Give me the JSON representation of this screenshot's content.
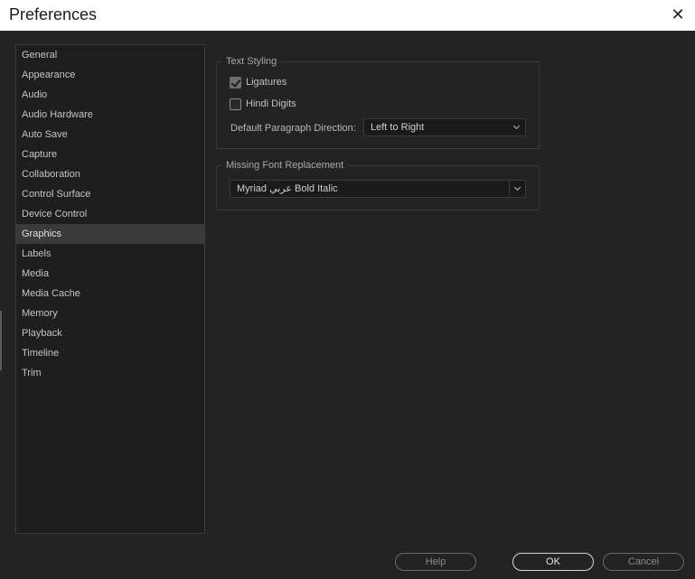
{
  "window": {
    "title": "Preferences",
    "close_icon": "close-icon"
  },
  "sidebar": {
    "items": [
      {
        "label": "General"
      },
      {
        "label": "Appearance"
      },
      {
        "label": "Audio"
      },
      {
        "label": "Audio Hardware"
      },
      {
        "label": "Auto Save"
      },
      {
        "label": "Capture"
      },
      {
        "label": "Collaboration"
      },
      {
        "label": "Control Surface"
      },
      {
        "label": "Device Control"
      },
      {
        "label": "Graphics",
        "selected": true
      },
      {
        "label": "Labels"
      },
      {
        "label": "Media"
      },
      {
        "label": "Media Cache"
      },
      {
        "label": "Memory"
      },
      {
        "label": "Playback"
      },
      {
        "label": "Timeline"
      },
      {
        "label": "Trim"
      }
    ]
  },
  "text_styling": {
    "legend": "Text Styling",
    "ligatures": {
      "label": "Ligatures",
      "checked": true
    },
    "hindi_digits": {
      "label": "Hindi Digits",
      "checked": false
    },
    "paragraph_direction": {
      "label": "Default Paragraph Direction:",
      "value": "Left to Right"
    }
  },
  "missing_font": {
    "legend": "Missing Font Replacement",
    "value": "Myriad عربي Bold Italic"
  },
  "footer": {
    "help": "Help",
    "ok": "OK",
    "cancel": "Cancel"
  }
}
